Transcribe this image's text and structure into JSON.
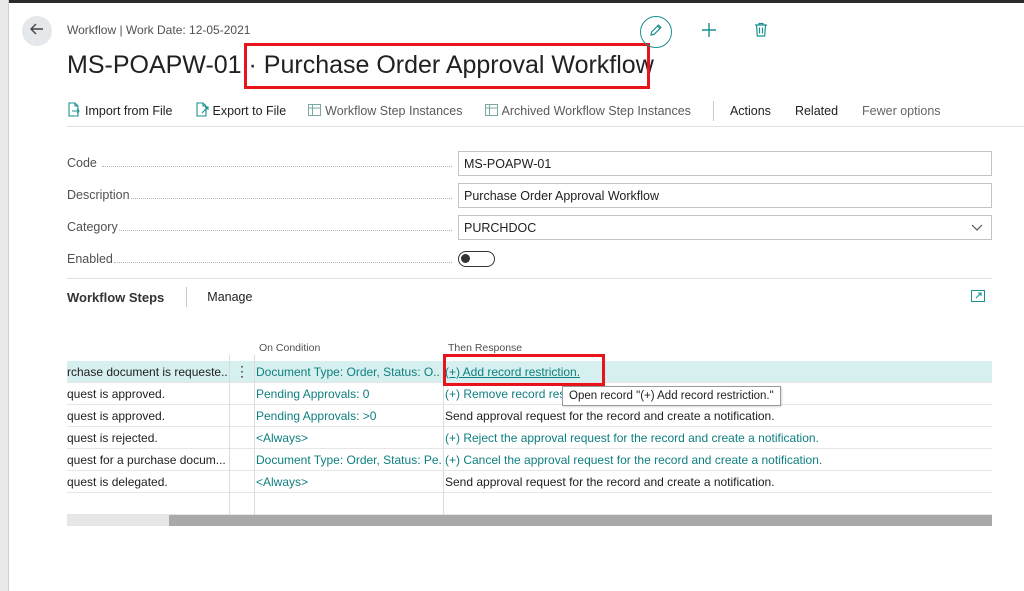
{
  "header": {
    "breadcrumb": "Workflow | Work Date: 12-05-2021",
    "title": "MS-POAPW-01 · Purchase Order Approval Workflow",
    "icons": [
      "back-arrow-icon",
      "pencil-icon",
      "plus-icon",
      "trash-icon"
    ]
  },
  "actions": {
    "import": "Import from File",
    "export": "Export to File",
    "instances": "Workflow Step Instances",
    "archived": "Archived Workflow Step Instances",
    "actions": "Actions",
    "related": "Related",
    "fewer": "Fewer options"
  },
  "fields": {
    "code_label": "Code",
    "code_value": "MS-POAPW-01",
    "description_label": "Description",
    "description_value": "Purchase Order Approval Workflow",
    "category_label": "Category",
    "category_value": "PURCHDOC",
    "enabled_label": "Enabled",
    "enabled_value": false
  },
  "steps": {
    "title": "Workflow Steps",
    "manage": "Manage",
    "columns": {
      "on_condition": "On Condition",
      "then_response": "Then Response"
    },
    "rows": [
      {
        "when": "rchase document is requeste...",
        "condition": "Document Type: Order, Status: O...",
        "response": "(+) Add record restriction."
      },
      {
        "when": "quest is approved.",
        "condition": "Pending Approvals: 0",
        "response": "(+) Remove record res"
      },
      {
        "when": "quest is approved.",
        "condition": "Pending Approvals: >0",
        "response": "Send approval request for the record and create a notification."
      },
      {
        "when": "quest is rejected.",
        "condition": "<Always>",
        "response": "(+) Reject the approval request for the record and create a notification."
      },
      {
        "when": "quest for a purchase docum...",
        "condition": "Document Type: Order, Status: Pe...",
        "response": "(+) Cancel the approval request for the record and create a notification."
      },
      {
        "when": "quest is delegated.",
        "condition": "<Always>",
        "response": "Send approval request for the record and create a notification."
      },
      {
        "when": "",
        "condition": "",
        "response": ""
      }
    ],
    "tooltip": "Open record \"(+) Add record restriction.\""
  },
  "colors": {
    "accent": "#0e7f7f",
    "highlight_box": "#e8141b",
    "selected_row": "#d6efef"
  }
}
